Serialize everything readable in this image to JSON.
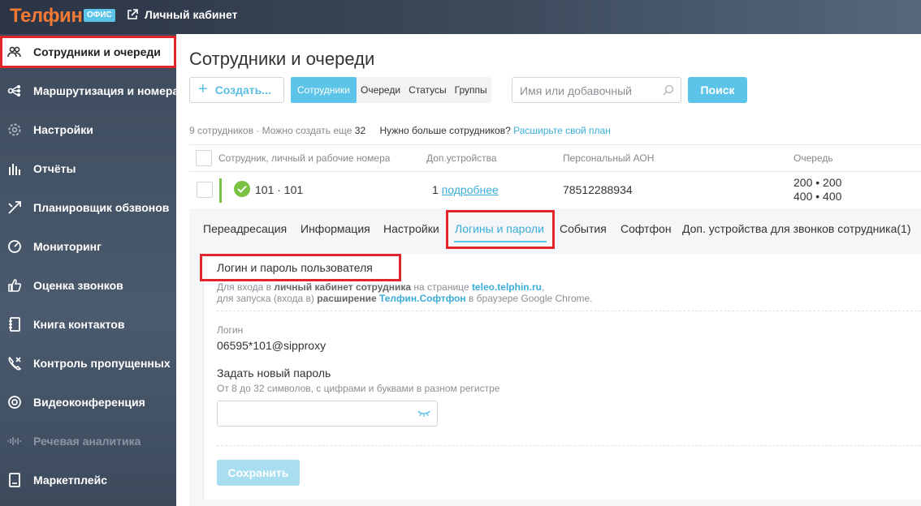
{
  "brand": {
    "logo": "Телфин",
    "badge": "ОФИС",
    "accent": "#5bc4e8",
    "logo_color": "#f27a35"
  },
  "header": {
    "cabinet_link": "Личный кабинет"
  },
  "sidebar": {
    "items": [
      {
        "label": "Сотрудники и очереди",
        "icon": "users-icon",
        "active": true
      },
      {
        "label": "Маршрутизация и номера",
        "icon": "routing-icon"
      },
      {
        "label": "Настройки",
        "icon": "gear-icon"
      },
      {
        "label": "Отчёты",
        "icon": "bar-chart-icon"
      },
      {
        "label": "Планировщик обзвонов",
        "icon": "dialer-icon"
      },
      {
        "label": "Мониторинг",
        "icon": "gauge-icon"
      },
      {
        "label": "Оценка звонков",
        "icon": "thumbs-up-icon"
      },
      {
        "label": "Книга контактов",
        "icon": "contact-book-icon"
      },
      {
        "label": "Контроль пропущенных",
        "icon": "missed-call-icon"
      },
      {
        "label": "Видеоконференция",
        "icon": "video-icon"
      },
      {
        "label": "Речевая аналитика",
        "icon": "waveform-icon",
        "disabled": true
      },
      {
        "label": "Маркетплейс",
        "icon": "marketplace-icon"
      }
    ]
  },
  "main": {
    "title": "Сотрудники и очереди",
    "create_label": "Создать...",
    "segments": [
      "Сотрудники",
      "Очереди",
      "Статусы",
      "Группы"
    ],
    "search_placeholder": "Имя или добавочный",
    "search_button": "Поиск",
    "info": {
      "count_text": "9 сотрудников · Можно создать еще",
      "count_num": "32",
      "more_text": "Нужно больше сотрудников?",
      "more_link": "Расширьте свой план"
    },
    "table": {
      "headers": [
        "Сотрудник, личный и рабочие номера",
        "Доп.устройства",
        "Персональный АОН",
        "Очередь"
      ],
      "row": {
        "name": "101 · 101",
        "devices_count": "1",
        "devices_link": "подробнее",
        "caller_id": "78512288934",
        "queue_1": "200 • 200",
        "queue_2": "400 • 400"
      }
    },
    "tabs": [
      "Переадресация",
      "Информация",
      "Настройки",
      "Логины и пароли",
      "События",
      "Софтфон",
      "Доп. устройства для звонков сотрудника(1)"
    ],
    "panel": {
      "section_title": "Логин и пароль пользователя",
      "desc1_a": "Для входа в",
      "desc1_b": "личный кабинет сотрудника",
      "desc1_c": "на странице",
      "desc1_link": "teleo.telphin.ru",
      "desc1_d": ",",
      "desc2_a": "для запуска (входа в)",
      "desc2_b": "расширение",
      "desc2_link": "Телфин.Софтфон",
      "desc2_c": "в браузере Google Chrome.",
      "login_label": "Логин",
      "login_value": "06595*101@sipproxy",
      "new_password_label": "Задать новый пароль",
      "password_hint": "От 8 до 32 символов, с цифрами и буквами в разном регистре",
      "password_value": "",
      "save_button": "Сохранить"
    }
  }
}
